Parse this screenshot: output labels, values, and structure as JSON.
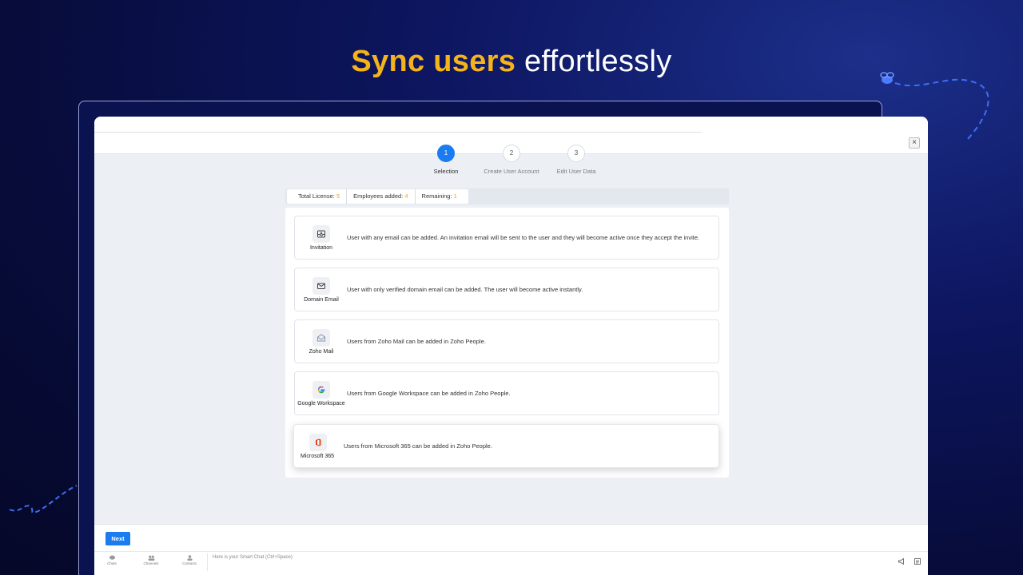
{
  "headline": {
    "accent": "Sync users",
    "rest": " effortlessly"
  },
  "dialog": {
    "close_label": "×",
    "steps": [
      {
        "num": "1",
        "label": "Selection",
        "active": true
      },
      {
        "num": "2",
        "label": "Create User Account",
        "active": false
      },
      {
        "num": "3",
        "label": "Edit User Data",
        "active": false
      }
    ],
    "license": {
      "total_label": "Total License:",
      "total_value": "5",
      "employees_label": "Employees added:",
      "employees_value": "4",
      "remaining_label": "Remaining:",
      "remaining_value": "1"
    },
    "options": [
      {
        "name": "Invitation",
        "icon": "inbox-icon",
        "desc": "User with any email can be added. An invitation email will be sent to the user and they will become active once they accept the invite."
      },
      {
        "name": "Domain Email",
        "icon": "mail-icon",
        "desc": "User with only verified domain email can be added. The user will become active instantly."
      },
      {
        "name": "Zoho Mail",
        "icon": "zoho-mail-icon",
        "desc": "Users from Zoho Mail can be added in Zoho People."
      },
      {
        "name": "Google Workspace",
        "icon": "google-icon",
        "desc": "Users from Google Workspace can be added in Zoho People."
      },
      {
        "name": "Microsoft 365",
        "icon": "microsoft-365-icon",
        "desc": "Users from Microsoft 365 can be added in Zoho People."
      }
    ],
    "next_label": "Next"
  },
  "chatbar": {
    "tabs": [
      "Chats",
      "Channels",
      "Contacts"
    ],
    "placeholder": "Here is your Smart Chat (Ctrl+Space)"
  },
  "colors": {
    "accent": "#f5b31b",
    "primary": "#1a7cf0",
    "background": "#070c3a"
  }
}
